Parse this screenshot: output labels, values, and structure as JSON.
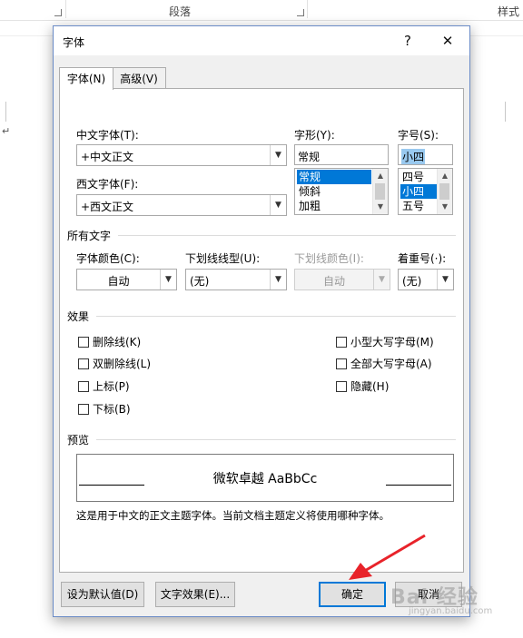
{
  "ribbon": {
    "group_paragraph": "段落",
    "group_styles": "样式"
  },
  "doc": {
    "paragraph_mark": "↵"
  },
  "dialog": {
    "title": "字体",
    "help": "?",
    "close": "✕",
    "tabs": [
      {
        "label": "字体(N)",
        "active": true
      },
      {
        "label": "高级(V)",
        "active": false
      }
    ],
    "chinese_font": {
      "label": "中文字体(T):",
      "value": "+中文正文"
    },
    "western_font": {
      "label": "西文字体(F):",
      "value": "+西文正文"
    },
    "font_style": {
      "label": "字形(Y):",
      "value": "常规",
      "options": [
        "常规",
        "倾斜",
        "加粗"
      ],
      "selected": "常规"
    },
    "font_size": {
      "label": "字号(S):",
      "value": "小四",
      "options": [
        "四号",
        "小四",
        "五号"
      ],
      "selected": "小四"
    },
    "all_text": {
      "section": "所有文字",
      "font_color": {
        "label": "字体颜色(C):",
        "value": "自动"
      },
      "underline_style": {
        "label": "下划线线型(U):",
        "value": "(无)"
      },
      "underline_color": {
        "label": "下划线颜色(I):",
        "value": "自动"
      },
      "emphasis": {
        "label": "着重号(·):",
        "value": "(无)"
      }
    },
    "effects": {
      "section": "效果",
      "strikethrough": "删除线(K)",
      "double_strikethrough": "双删除线(L)",
      "superscript": "上标(P)",
      "subscript": "下标(B)",
      "small_caps": "小型大写字母(M)",
      "all_caps": "全部大写字母(A)",
      "hidden": "隐藏(H)"
    },
    "preview": {
      "section": "预览",
      "sample": "微软卓越  AaBbCc",
      "note": "这是用于中文的正文主题字体。当前文档主题定义将使用哪种字体。"
    },
    "buttons": {
      "set_default": "设为默认值(D)",
      "text_effects": "文字效果(E)...",
      "ok": "确定",
      "cancel": "取消"
    }
  },
  "watermark": {
    "brand": "Bai 经验",
    "url": "jingyan.baidu.com"
  },
  "colors": {
    "accent": "#0078d7",
    "annotation_arrow": "#e8232a"
  }
}
